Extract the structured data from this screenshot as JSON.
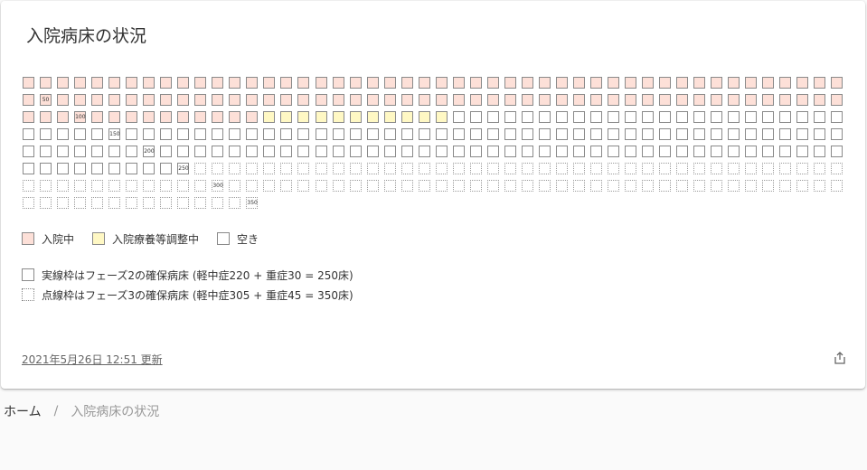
{
  "card": {
    "title": "入院病床の状況",
    "updated_text": "2021年5月26日 12:51 更新"
  },
  "beds": {
    "total": 350,
    "hospitalized": 110,
    "adjusting": 11,
    "solid_frame_count": 250,
    "milestone_labels": [
      "50",
      "100",
      "150",
      "200",
      "250",
      "300",
      "350"
    ],
    "colors": {
      "hospitalized_fill": "#fde0d8",
      "adjusting_fill": "#fff8c4",
      "empty_fill": "#ffffff",
      "border": "#8a8a8a"
    }
  },
  "legend": {
    "hospitalized": "入院中",
    "adjusting": "入院療養等調整中",
    "vacant": "空き"
  },
  "frame_notes": {
    "solid": "実線枠はフェーズ2の確保病床 (軽中症220 + 重症30 = 250床)",
    "dotted": "点線枠はフェーズ3の確保病床 (軽中症305 + 重症45 = 350床)"
  },
  "breadcrumb": {
    "home": "ホーム",
    "separator": "/",
    "current": "入院病床の状況"
  },
  "icons": {
    "share": "share-icon"
  }
}
